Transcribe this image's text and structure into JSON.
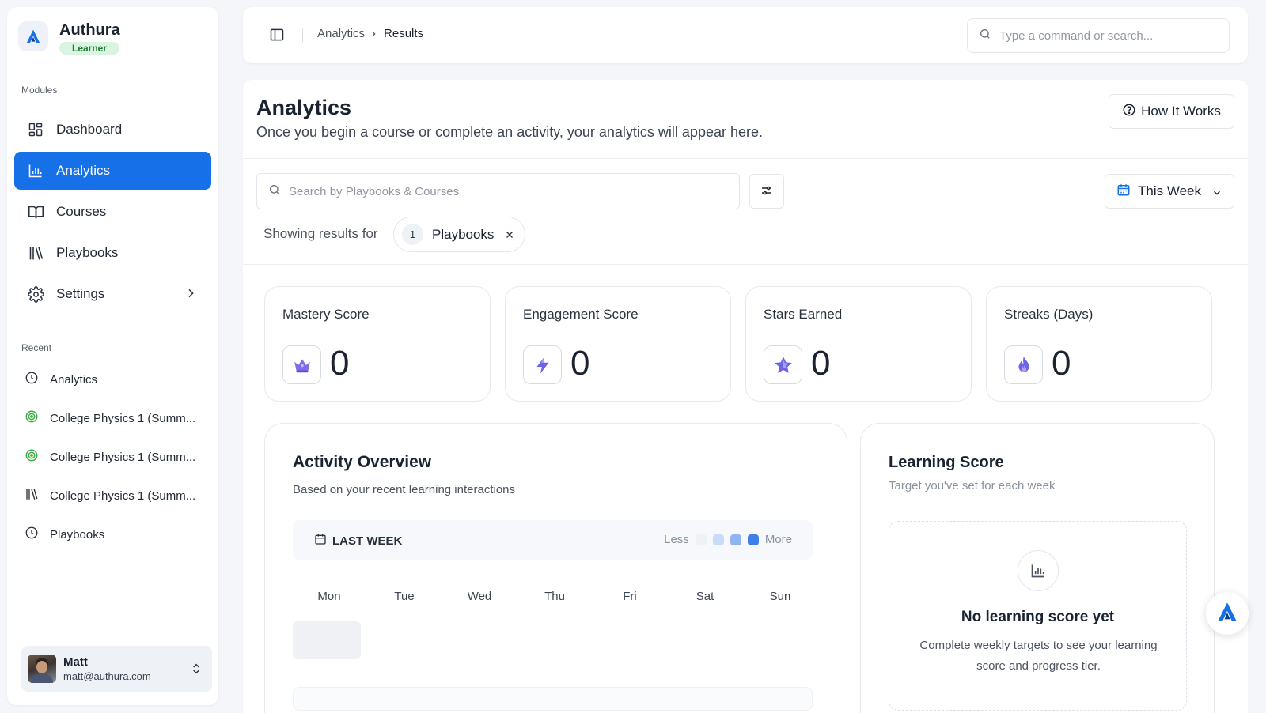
{
  "brand": {
    "name": "Authura",
    "role_badge": "Learner"
  },
  "sidebar": {
    "modules_label": "Modules",
    "items": [
      {
        "label": "Dashboard",
        "icon": "dashboard-icon"
      },
      {
        "label": "Analytics",
        "icon": "bar-chart-icon",
        "active": true
      },
      {
        "label": "Courses",
        "icon": "book-open-icon"
      },
      {
        "label": "Playbooks",
        "icon": "library-icon"
      },
      {
        "label": "Settings",
        "icon": "gear-icon",
        "has_submenu": true
      }
    ],
    "recent_label": "Recent",
    "recent": [
      {
        "label": "Analytics",
        "icon": "clock-icon"
      },
      {
        "label": "College Physics 1 (Summ...",
        "icon": "target-icon"
      },
      {
        "label": "College Physics 1 (Summ...",
        "icon": "target-icon"
      },
      {
        "label": "College Physics 1 (Summ...",
        "icon": "library-icon"
      },
      {
        "label": "Playbooks",
        "icon": "clock-icon"
      }
    ]
  },
  "user": {
    "name": "Matt",
    "email": "matt@authura.com"
  },
  "topbar": {
    "breadcrumb": [
      "Analytics",
      "Results"
    ],
    "search_placeholder": "Type a command or search..."
  },
  "page": {
    "title": "Analytics",
    "subtitle": "Once you begin a course or complete an activity, your analytics will appear here.",
    "how_it_works": "How It Works"
  },
  "filters": {
    "search_placeholder": "Search by Playbooks & Courses",
    "period": "This Week",
    "showing_label": "Showing results for",
    "chip": {
      "count": "1",
      "label": "Playbooks"
    }
  },
  "stats": [
    {
      "title": "Mastery Score",
      "value": "0",
      "icon": "crown-icon"
    },
    {
      "title": "Engagement Score",
      "value": "0",
      "icon": "lightning-icon"
    },
    {
      "title": "Stars Earned",
      "value": "0",
      "icon": "star-icon"
    },
    {
      "title": "Streaks (Days)",
      "value": "0",
      "icon": "flame-icon"
    }
  ],
  "activity": {
    "title": "Activity Overview",
    "subtitle": "Based on your recent learning interactions",
    "period": "LAST WEEK",
    "legend_less": "Less",
    "legend_more": "More",
    "legend_colors": [
      "#eef1f6",
      "#c9dbfa",
      "#8fb4f1",
      "#3f7fe6"
    ],
    "days": [
      "Mon",
      "Tue",
      "Wed",
      "Thu",
      "Fri",
      "Sat",
      "Sun"
    ]
  },
  "learning": {
    "title": "Learning Score",
    "subtitle": "Target you've set for each week",
    "empty_title": "No learning score yet",
    "empty_text": "Complete weekly targets to see your learning score and progress tier."
  },
  "colors": {
    "accent": "#1670e8",
    "badge_green": "#d9f5df",
    "recent_target": "#3fae4b"
  }
}
